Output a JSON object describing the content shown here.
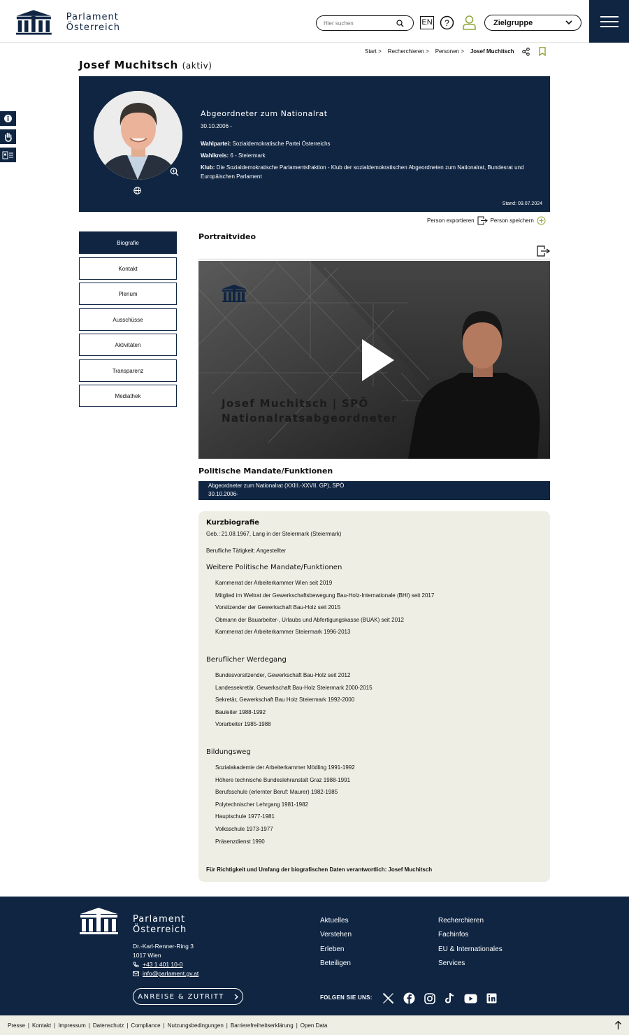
{
  "header": {
    "logo_line1": "Parlament",
    "logo_line2": "Österreich",
    "search_placeholder": "Hier suchen",
    "lang": "EN",
    "target_group": "Zielgruppe"
  },
  "breadcrumb": [
    "Start >",
    "Recherchieren >",
    "Personen >",
    "Josef Muchitsch"
  ],
  "person": {
    "name": "Josef Muchitsch",
    "status": "(aktiv)",
    "role": "Abgeordneter zum Nationalrat",
    "since": "30.10.2006 -",
    "party_label": "Wahlpartei:",
    "party": "Sozialdemokratische Partei Österreichs",
    "district_label": "Wahlkreis:",
    "district": "6 - Steiermark",
    "club_label": "Klub:",
    "club": "Die Sozialdemokratische Parlamentsfraktion - Klub der sozialdemokratischen Abgeordneten zum Nationalrat, Bundesrat und Europäischen Parlament",
    "stand": "Stand: 09.07.2024"
  },
  "actions": {
    "export": "Person exportieren",
    "save": "Person speichern"
  },
  "tabs": [
    "Biografie",
    "Kontakt",
    "Plenum",
    "Ausschüsse",
    "Aktivitäten",
    "Transparenz",
    "Mediathek"
  ],
  "video": {
    "section_title": "Portraitvideo",
    "overlay_line1": "Josef Muchitsch | SPÖ",
    "overlay_line2": "Nationalratsabgeordneter"
  },
  "mandates": {
    "title": "Politische Mandate/Funktionen",
    "line1": "Abgeordneter zum Nationalrat (XXIII.-XXVII. GP), SPÖ",
    "line2": "30.10.2006-"
  },
  "bio": {
    "title": "Kurzbiografie",
    "born": "Geb.: 21.08.1967, Lang in der Steiermark (Steiermark)",
    "job": "Berufliche Tätigkeit: Angestellter",
    "further_title": "Weitere Politische Mandate/Funktionen",
    "further": [
      "Kammerrat der Arbeiterkammer Wien seit 2019",
      "Mitglied im Weltrat der Gewerkschaftsbewegung Bau-Holz-Internationale (BHI) seit 2017",
      "Vorsitzender der Gewerkschaft Bau-Holz seit 2015",
      "Obmann der Bauarbeiter-, Urlaubs und Abfertigungskasse (BUAK) seit 2012",
      "Kammerrat der Arbeiterkammer Steiermark 1996-2013"
    ],
    "career_title": "Beruflicher Werdegang",
    "career": [
      "Bundesvorsitzender, Gewerkschaft Bau-Holz seit 2012",
      "Landessekretär, Gewerkschaft Bau-Holz Steiermark 2000-2015",
      "Sekretär, Gewerkschaft Bau Holz Steiermark 1992-2000",
      "Bauleiter 1988-1992",
      "Vorarbeiter 1985-1988"
    ],
    "edu_title": "Bildungsweg",
    "edu": [
      "Sozialakademie der Arbeiterkammer Mödling 1991-1992",
      "Höhere technische Bundeslehranstalt Graz 1988-1991",
      "Berufsschule (erlernter Beruf: Maurer) 1982-1985",
      "Polytechnischer Lehrgang 1981-1982",
      "Hauptschule 1977-1981",
      "Volksschule 1973-1977",
      "Präsenzdienst 1990"
    ],
    "disclaimer": "Für Richtigkeit und Umfang der biografischen Daten verantwortlich: Josef Muchitsch"
  },
  "footer": {
    "logo_line1": "Parlament",
    "logo_line2": "Österreich",
    "address1": "Dr.-Karl-Renner-Ring 3",
    "address2": "1017 Wien",
    "phone": "+43 1 401 10-0",
    "email": "info@parlament.gv.at",
    "cta": "ANREISE & ZUTRITT",
    "col1": [
      "Aktuelles",
      "Verstehen",
      "Erleben",
      "Beteiligen"
    ],
    "col2": [
      "Recherchieren",
      "Fachinfos",
      "EU & Internationales",
      "Services"
    ],
    "follow": "FOLGEN SIE UNS:"
  },
  "bottom_links": [
    "Presse",
    "Kontakt",
    "Impressum",
    "Datenschutz",
    "Compliance",
    "Nutzungsbedingungen",
    "Barrierefreiheitserklärung",
    "Open Data"
  ],
  "colors": {
    "navy": "#0f2542",
    "beige": "#efeee4",
    "accent_green": "#8fa83a"
  }
}
